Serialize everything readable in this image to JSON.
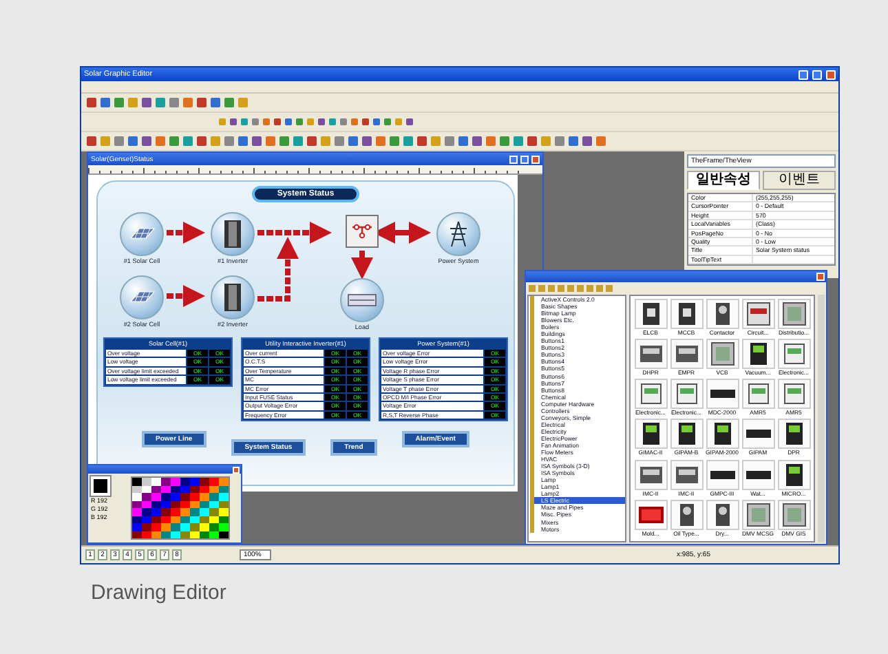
{
  "window": {
    "title": "Solar Graphic Editor"
  },
  "document": {
    "title": "Solar(Genset)Status",
    "header": "System Status",
    "nodes": [
      {
        "kind": "solar",
        "label": "#1 Solar Cell"
      },
      {
        "kind": "inverter",
        "label": "#1 Inverter"
      },
      {
        "kind": "switch"
      },
      {
        "kind": "tower",
        "label": "Power System"
      },
      {
        "kind": "solar",
        "label": "#2 Solar Cell"
      },
      {
        "kind": "inverter",
        "label": "#2 Inverter"
      },
      {
        "kind": "load",
        "label": "Load"
      }
    ],
    "tables": [
      {
        "title": "Solar Cell(#1)",
        "rows": [
          {
            "label": "Over voltage",
            "values": [
              "OK",
              "OK"
            ]
          },
          {
            "label": "Low voltage",
            "values": [
              "OK",
              "OK"
            ]
          },
          {
            "label": "Over voltage limit exceeded",
            "values": [
              "OK",
              "OK"
            ]
          },
          {
            "label": "Low voltage limit exceeded",
            "values": [
              "OK",
              "OK"
            ]
          }
        ]
      },
      {
        "title": "Utility Interactive Inverter(#1)",
        "rows": [
          {
            "label": "Over current",
            "values": [
              "OK",
              "OK"
            ]
          },
          {
            "label": "O.C.T.S",
            "values": [
              "OK",
              "OK"
            ]
          },
          {
            "label": "Over Temperature",
            "values": [
              "OK",
              "OK"
            ]
          },
          {
            "label": "MC",
            "values": [
              "OK",
              "OK"
            ]
          },
          {
            "label": "MC Error",
            "values": [
              "OK",
              "OK"
            ]
          },
          {
            "label": "Input FUSE Status",
            "values": [
              "OK",
              "OK"
            ]
          },
          {
            "label": "Output Voltage Error",
            "values": [
              "OK",
              "OK"
            ]
          },
          {
            "label": "Frequency Error",
            "values": [
              "OK",
              "OK"
            ]
          }
        ]
      },
      {
        "title": "Power System(#1)",
        "rows": [
          {
            "label": "Over voltage Error",
            "values": [
              "OK"
            ]
          },
          {
            "label": "Low voltage Error",
            "values": [
              "OK"
            ]
          },
          {
            "label": "Voltage R phase Error",
            "values": [
              "OK"
            ]
          },
          {
            "label": "Voltage S phase Error",
            "values": [
              "OK"
            ]
          },
          {
            "label": "Voltage T phase Error",
            "values": [
              "OK"
            ]
          },
          {
            "label": "OPCD M/I Phase Error",
            "values": [
              "OK"
            ]
          },
          {
            "label": "Voltage Error",
            "values": [
              "OK"
            ]
          },
          {
            "label": "R,S,T Reverse Phase",
            "values": [
              "OK"
            ]
          }
        ]
      }
    ],
    "buttons": [
      "Power Line",
      "System Status",
      "Trend",
      "Alarm/Event"
    ]
  },
  "properties": {
    "object": "TheFrame/TheView",
    "tabs": [
      {
        "label": "일반속성",
        "selected": true
      },
      {
        "label": "이벤트",
        "selected": false
      }
    ],
    "rows": [
      {
        "name": "Color",
        "value": "(255,255,255)"
      },
      {
        "name": "CursorPointer",
        "value": "0 - Default"
      },
      {
        "name": "Height",
        "value": "570"
      },
      {
        "name": "LocalVariables",
        "value": "(Class)"
      },
      {
        "name": "PosPageNo",
        "value": "0 - No"
      },
      {
        "name": "Quality",
        "value": "0 - Low"
      },
      {
        "name": "Title",
        "value": "Solar System status"
      },
      {
        "name": "ToolTipText"
      }
    ]
  },
  "library": {
    "categories": [
      {
        "label": "ActiveX Controls 2.0",
        "selected": false
      },
      {
        "label": "Basic Shapes",
        "selected": false
      },
      {
        "label": "Bitmap Lamp",
        "selected": false
      },
      {
        "label": "Blowers Etc.",
        "selected": false
      },
      {
        "label": "Boilers",
        "selected": false
      },
      {
        "label": "Buildings",
        "selected": false
      },
      {
        "label": "Buttons1",
        "selected": false
      },
      {
        "label": "Buttons2",
        "selected": false
      },
      {
        "label": "Buttons3",
        "selected": false
      },
      {
        "label": "Buttons4",
        "selected": false
      },
      {
        "label": "Buttons5",
        "selected": false
      },
      {
        "label": "Buttons6",
        "selected": false
      },
      {
        "label": "Buttons7",
        "selected": false
      },
      {
        "label": "Buttons8",
        "selected": false
      },
      {
        "label": "Chemical",
        "selected": false
      },
      {
        "label": "Computer Hardware",
        "selected": false
      },
      {
        "label": "Controllers",
        "selected": false
      },
      {
        "label": "Conveyors, Simple",
        "selected": false
      },
      {
        "label": "Electrical",
        "selected": false
      },
      {
        "label": "Electricity",
        "selected": false
      },
      {
        "label": "ElectricPower",
        "selected": false
      },
      {
        "label": "Fan Animation",
        "selected": false
      },
      {
        "label": "Flow Meters",
        "selected": false
      },
      {
        "label": "HVAC",
        "selected": false
      },
      {
        "label": "ISA Symbols (3-D)",
        "selected": false
      },
      {
        "label": "ISA Symbols",
        "selected": false
      },
      {
        "label": "Lamp",
        "selected": false
      },
      {
        "label": "Lamp1",
        "selected": false
      },
      {
        "label": "Lamp2",
        "selected": false
      },
      {
        "label": "LS Electric",
        "selected": true
      },
      {
        "label": "Maze and Pipes",
        "selected": false
      },
      {
        "label": "Misc. Pipes",
        "selected": false
      },
      {
        "label": "Mixers",
        "selected": false
      },
      {
        "label": "Motors",
        "selected": false
      }
    ],
    "symbols": [
      {
        "kind": "breaker",
        "label": "ELCB"
      },
      {
        "kind": "breaker",
        "label": "MCCB"
      },
      {
        "kind": "contactor",
        "label": "Contactor"
      },
      {
        "kind": "breaker3",
        "label": "Circuit..."
      },
      {
        "kind": "panel",
        "label": "Distributio..."
      },
      {
        "kind": "relay",
        "label": "DHPR"
      },
      {
        "kind": "relay",
        "label": "EMPR"
      },
      {
        "kind": "panel",
        "label": "VCB"
      },
      {
        "kind": "cabinet",
        "label": "Vacuum..."
      },
      {
        "kind": "meter",
        "label": "Electronic..."
      },
      {
        "kind": "meter",
        "label": "Electronic..."
      },
      {
        "kind": "meter",
        "label": "Electronic..."
      },
      {
        "kind": "strip",
        "label": "MDC-2000"
      },
      {
        "kind": "meter",
        "label": "AMR5"
      },
      {
        "kind": "meter",
        "label": "AMR5"
      },
      {
        "kind": "cabinet",
        "label": "GIMAC-II"
      },
      {
        "kind": "cabinet",
        "label": "GIPAM-B"
      },
      {
        "kind": "cabinet",
        "label": "GIPAM-2000"
      },
      {
        "kind": "strip",
        "label": "GIPAM"
      },
      {
        "kind": "cabinet",
        "label": "DPR"
      },
      {
        "kind": "relay",
        "label": "IMC-II"
      },
      {
        "kind": "relay",
        "label": "IMC-II"
      },
      {
        "kind": "strip",
        "label": "GMPC-III"
      },
      {
        "kind": "strip",
        "label": "Wat..."
      },
      {
        "kind": "cabinet",
        "label": "MICRO..."
      },
      {
        "kind": "transformer",
        "label": "Mold..."
      },
      {
        "kind": "contactor",
        "label": "Oil Type..."
      },
      {
        "kind": "contactor",
        "label": "Dry..."
      },
      {
        "kind": "panel",
        "label": "DMV MCSG"
      },
      {
        "kind": "panel",
        "label": "DMV GIS"
      }
    ]
  },
  "palette": {
    "readouts": [
      "R 192",
      "G 192",
      "B 192"
    ]
  },
  "status_bar": {
    "pages": [
      "1",
      "2",
      "3",
      "4",
      "5",
      "6",
      "7",
      "8"
    ],
    "zoom": "100%",
    "position": "x:985, y:65"
  },
  "caption": "Drawing Editor"
}
